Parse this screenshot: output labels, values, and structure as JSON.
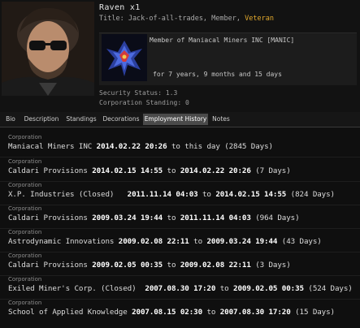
{
  "character": {
    "name": "Raven x1",
    "title_prefix": "Title: Jack-of-all-trades, Member, ",
    "title_rank": "Veteran",
    "corp_member": "Member of Maniacal Miners INC [MANIC]",
    "corp_tenure": "for 7 years, 9 months and 15 days",
    "security_status": "Security Status: 1.3",
    "corporation_standing": "Corporation Standing: 0"
  },
  "tabs": [
    "Bio",
    "Description",
    "Standings",
    "Decorations",
    "Employment History",
    "Notes"
  ],
  "active_tab": "Employment History",
  "history": [
    {
      "label": "Corporation",
      "corp": "Maniacal Miners INC",
      "start": "2014.02.22 20:26",
      "sep": "to",
      "end": "this day",
      "days": "(2845 Days)"
    },
    {
      "label": "Corporation",
      "corp": "Caldari Provisions",
      "start": "2014.02.15 14:55",
      "sep": "to",
      "end": "2014.02.22 20:26",
      "days": "(7 Days)"
    },
    {
      "label": "Corporation",
      "corp": "X.P. Industries (Closed)",
      "start": "2011.11.14 04:03",
      "sep": "to",
      "end": "2014.02.15 14:55",
      "days": "(824 Days)"
    },
    {
      "label": "Corporation",
      "corp": "Caldari Provisions",
      "start": "2009.03.24 19:44",
      "sep": "to",
      "end": "2011.11.14 04:03",
      "days": "(964 Days)"
    },
    {
      "label": "Corporation",
      "corp": "Astrodynamic Innovations",
      "start": "2009.02.08 22:11",
      "sep": "to",
      "end": "2009.03.24 19:44",
      "days": "(43 Days)"
    },
    {
      "label": "Corporation",
      "corp": "Caldari Provisions",
      "start": "2009.02.05 00:35",
      "sep": "to",
      "end": "2009.02.08 22:11",
      "days": "(3 Days)"
    },
    {
      "label": "Corporation",
      "corp": "Exiled Miner's Corp. (Closed)",
      "start": "2007.08.30 17:20",
      "sep": "to",
      "end": "2009.02.05 00:35",
      "days": "(524 Days)"
    },
    {
      "label": "Corporation",
      "corp": "School of Applied Knowledge",
      "start": "2007.08.15 02:30",
      "sep": "to",
      "end": "2007.08.30 17:20",
      "days": "(15 Days)"
    }
  ],
  "colors": {
    "background": "#121212",
    "active_tab": "#4a4a4a",
    "veteran_highlight": "#e2a92d"
  },
  "icons": {
    "portrait": "character-portrait",
    "corp_logo": "corporation-logo"
  }
}
